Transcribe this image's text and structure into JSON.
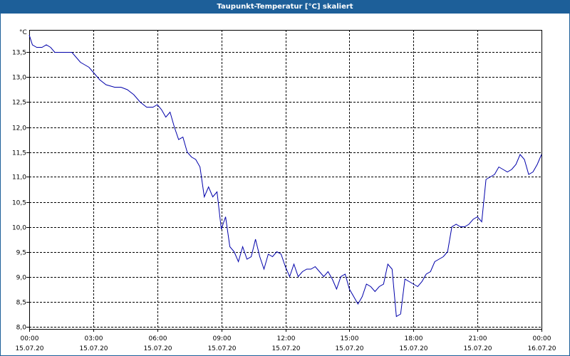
{
  "window": {
    "title": "Taupunkt-Temperatur [°C] skaliert"
  },
  "colors": {
    "titlebar": "#1d5f99",
    "line": "#0000aa",
    "grid": "#000000"
  },
  "chart_data": {
    "type": "line",
    "title": "Taupunkt-Temperatur [°C] skaliert",
    "ylabel": "°C",
    "xlabel": "",
    "ylim": [
      7.95,
      13.95
    ],
    "y_ticks": [
      "13,5",
      "13,0",
      "12,5",
      "12,0",
      "11,5",
      "11,0",
      "10,5",
      "10,0",
      "9,5",
      "9,0",
      "8,5",
      "8,0"
    ],
    "y_tick_values": [
      13.5,
      13.0,
      12.5,
      12.0,
      11.5,
      11.0,
      10.5,
      10.0,
      9.5,
      9.0,
      8.5,
      8.0
    ],
    "x_range_hours": [
      0,
      24
    ],
    "x_ticks": [
      {
        "time": "00:00",
        "date": "15.07.20",
        "h": 0
      },
      {
        "time": "03:00",
        "date": "15.07.20",
        "h": 3
      },
      {
        "time": "06:00",
        "date": "15.07.20",
        "h": 6
      },
      {
        "time": "09:00",
        "date": "15.07.20",
        "h": 9
      },
      {
        "time": "12:00",
        "date": "15.07.20",
        "h": 12
      },
      {
        "time": "15:00",
        "date": "15.07.20",
        "h": 15
      },
      {
        "time": "18:00",
        "date": "15.07.20",
        "h": 18
      },
      {
        "time": "21:00",
        "date": "15.07.20",
        "h": 21
      },
      {
        "time": "00:00",
        "date": "16.07.20",
        "h": 24
      }
    ],
    "grid": true,
    "series": [
      {
        "color": "#0000aa",
        "hours": [
          0,
          0.15,
          0.35,
          0.6,
          0.8,
          1.0,
          1.2,
          1.5,
          1.8,
          2.0,
          2.2,
          2.4,
          2.6,
          2.8,
          3.0,
          3.3,
          3.6,
          4.0,
          4.3,
          4.6,
          4.9,
          5.2,
          5.5,
          5.8,
          6.0,
          6.2,
          6.4,
          6.6,
          6.8,
          7.0,
          7.2,
          7.4,
          7.6,
          7.8,
          8.0,
          8.2,
          8.4,
          8.6,
          8.8,
          9.0,
          9.2,
          9.4,
          9.6,
          9.8,
          10.0,
          10.2,
          10.4,
          10.6,
          10.8,
          11.0,
          11.2,
          11.4,
          11.6,
          11.8,
          12.0,
          12.2,
          12.4,
          12.6,
          12.8,
          13.0,
          13.2,
          13.4,
          13.6,
          13.8,
          14.0,
          14.2,
          14.4,
          14.6,
          14.8,
          15.0,
          15.2,
          15.4,
          15.6,
          15.8,
          16.0,
          16.2,
          16.4,
          16.6,
          16.8,
          17.0,
          17.2,
          17.4,
          17.6,
          17.8,
          18.0,
          18.2,
          18.4,
          18.6,
          18.8,
          19.0,
          19.2,
          19.4,
          19.6,
          19.8,
          20.0,
          20.2,
          20.4,
          20.6,
          20.8,
          21.0,
          21.2,
          21.4,
          21.6,
          21.8,
          22.0,
          22.2,
          22.4,
          22.6,
          22.8,
          23.0,
          23.2,
          23.4,
          23.6,
          23.8,
          24.0
        ],
        "values": [
          13.85,
          13.65,
          13.6,
          13.6,
          13.65,
          13.6,
          13.5,
          13.5,
          13.5,
          13.5,
          13.4,
          13.3,
          13.25,
          13.2,
          13.1,
          12.95,
          12.85,
          12.8,
          12.8,
          12.75,
          12.65,
          12.5,
          12.4,
          12.4,
          12.45,
          12.35,
          12.2,
          12.3,
          12.0,
          11.75,
          11.8,
          11.5,
          11.4,
          11.35,
          11.2,
          10.6,
          10.8,
          10.6,
          10.7,
          9.95,
          10.2,
          9.6,
          9.5,
          9.3,
          9.6,
          9.35,
          9.4,
          9.75,
          9.4,
          9.15,
          9.45,
          9.4,
          9.5,
          9.45,
          9.2,
          9.0,
          9.25,
          9.0,
          9.1,
          9.15,
          9.15,
          9.2,
          9.1,
          9.0,
          9.1,
          8.95,
          8.75,
          9.0,
          9.05,
          8.75,
          8.6,
          8.45,
          8.6,
          8.85,
          8.8,
          8.7,
          8.8,
          8.85,
          9.25,
          9.15,
          8.2,
          8.25,
          8.95,
          8.9,
          8.85,
          8.8,
          8.9,
          9.05,
          9.1,
          9.3,
          9.35,
          9.4,
          9.5,
          10.0,
          10.05,
          10.0,
          10.0,
          10.05,
          10.15,
          10.2,
          10.1,
          10.95,
          11.0,
          11.05,
          11.2,
          11.15,
          11.1,
          11.15,
          11.25,
          11.45,
          11.35,
          11.05,
          11.1,
          11.25,
          11.45
        ]
      }
    ]
  }
}
